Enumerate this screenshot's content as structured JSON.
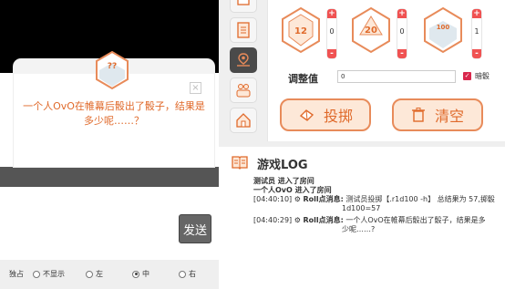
{
  "popup": {
    "dice_value": "??",
    "close_label": "×",
    "message": "一个人OvO在帷幕后骰出了骰子，结果是多少呢……？"
  },
  "chat": {
    "send_label": "发送",
    "radio_options": [
      {
        "label": "独占",
        "checked": false
      },
      {
        "label": "不显示",
        "checked": false
      },
      {
        "label": "左",
        "checked": false
      },
      {
        "label": "中",
        "checked": true
      },
      {
        "label": "右",
        "checked": false
      }
    ]
  },
  "dice": [
    {
      "faces": "12",
      "count": "0",
      "plus": "+",
      "minus": "-"
    },
    {
      "faces": "20",
      "count": "0",
      "plus": "+",
      "minus": "-"
    },
    {
      "faces": "100",
      "count": "1",
      "plus": "+",
      "minus": "-"
    }
  ],
  "roll_panel": {
    "adjust_label": "调整值",
    "adjust_value": "0",
    "dark_roll_label": "暗骰",
    "dark_roll_checked": true,
    "roll_label": "投掷",
    "clear_label": "清空"
  },
  "log": {
    "title": "游戏LOG",
    "lines": [
      {
        "text": "测试员 进入了房间"
      },
      {
        "text": "一个人OvO 进入了房间"
      },
      {
        "ts": "[04:40:10]",
        "tag": "Roll点消息:",
        "text": "测试员投掷【.r1d100 -h】 总结果为 57,掷骰",
        "text2": "1d100=57"
      },
      {
        "ts": "[04:40:29]",
        "tag": "Roll点消息:",
        "text": "一个人OvO在帷幕后骰出了骰子，结果是多",
        "text2": "少呢……?"
      }
    ]
  },
  "colors": {
    "accent": "#e06a2b",
    "counter_red": "#f05252",
    "checkbox": "#d9284d"
  }
}
